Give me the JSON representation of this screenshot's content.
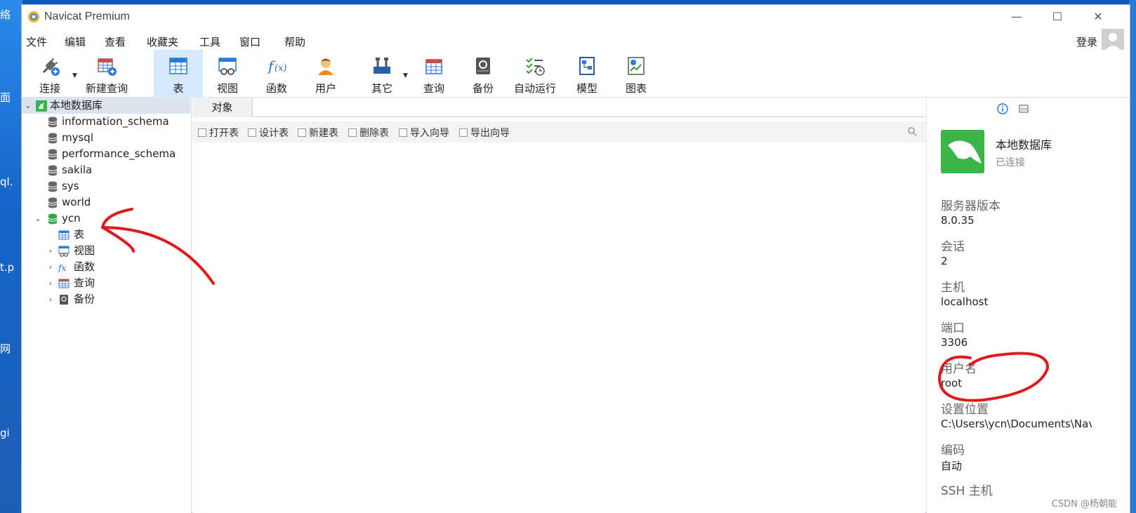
{
  "window": {
    "title": "Navicat Premium"
  },
  "menu": [
    "文件",
    "编辑",
    "查看",
    "收藏夹",
    "工具",
    "窗口",
    "帮助"
  ],
  "login_label": "登录",
  "toolbar": {
    "connect": "连接",
    "new_query": "新建查询",
    "table": "表",
    "view": "视图",
    "function": "函数",
    "user": "用户",
    "other": "其它",
    "query": "查询",
    "backup": "备份",
    "automation": "自动运行",
    "model": "模型",
    "chart": "图表"
  },
  "sidebar": {
    "connection": "本地数据库",
    "databases": [
      "information_schema",
      "mysql",
      "performance_schema",
      "sakila",
      "sys",
      "world",
      "ycn"
    ],
    "ycn_children": [
      "表",
      "视图",
      "函数",
      "查询",
      "备份"
    ]
  },
  "tabs": [
    "对象"
  ],
  "object_toolbar": [
    "打开表",
    "设计表",
    "新建表",
    "删除表",
    "导入向导",
    "导出向导"
  ],
  "info_panel": {
    "name": "本地数据库",
    "status": "已连接",
    "fields": [
      {
        "key": "服务器版本",
        "value": "8.0.35"
      },
      {
        "key": "会话",
        "value": "2"
      },
      {
        "key": "主机",
        "value": "localhost"
      },
      {
        "key": "端口",
        "value": "3306"
      },
      {
        "key": "用户名",
        "value": "root"
      },
      {
        "key": "设置位置",
        "value": "C:\\Users\\ycn\\Documents\\Navic"
      },
      {
        "key": "编码",
        "value": "自动"
      },
      {
        "key": "SSH 主机",
        "value": ""
      }
    ]
  },
  "watermark": "CSDN @杨朝能",
  "desktop_fragments": [
    "络",
    "面",
    "ql.",
    "t.p",
    "网",
    "gi"
  ],
  "colors": {
    "accent": "#d7e8fb",
    "annotation": "#e0191b",
    "db_green": "#3ab54a"
  }
}
